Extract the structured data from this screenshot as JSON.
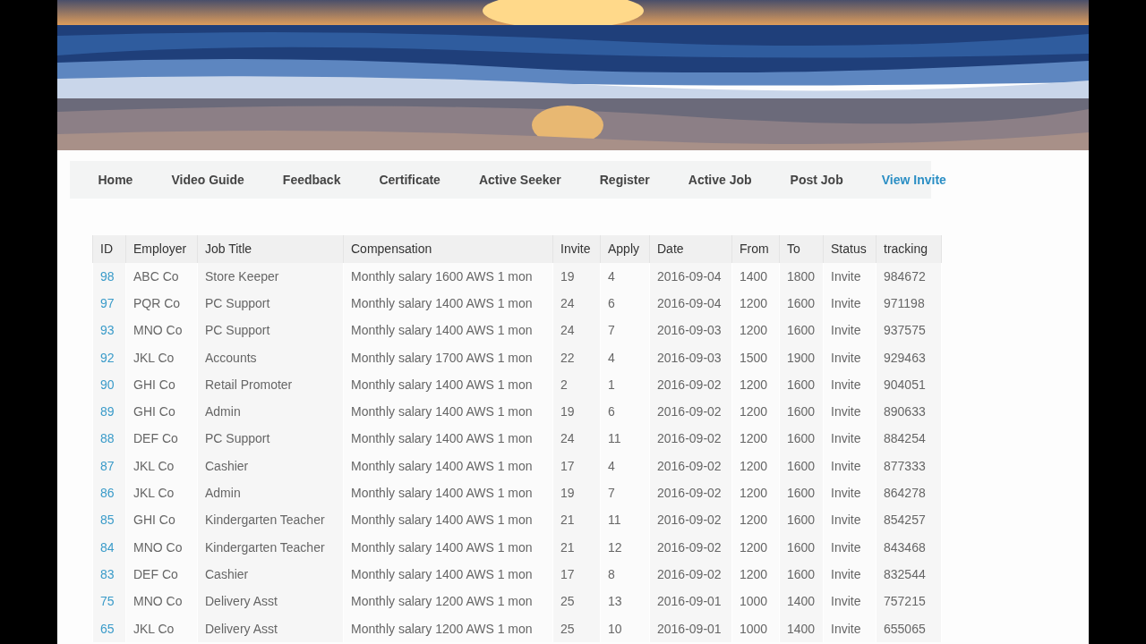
{
  "nav": [
    {
      "label": "Home",
      "selected": false
    },
    {
      "label": "Video Guide",
      "selected": false
    },
    {
      "label": "Feedback",
      "selected": false
    },
    {
      "label": "Certificate",
      "selected": false
    },
    {
      "label": "Active Seeker",
      "selected": false
    },
    {
      "label": "Register",
      "selected": false
    },
    {
      "label": "Active Job",
      "selected": false
    },
    {
      "label": "Post Job",
      "selected": false
    },
    {
      "label": "View Invite",
      "selected": true
    }
  ],
  "table": {
    "columns": [
      "ID",
      "Employer",
      "Job Title",
      "Compensation",
      "Invite",
      "Apply",
      "Date",
      "From",
      "To",
      "Status",
      "tracking"
    ],
    "rows": [
      [
        "98",
        "ABC Co",
        "Store Keeper",
        "Monthly salary 1600 AWS 1 mon",
        "19",
        "4",
        "2016-09-04",
        "1400",
        "1800",
        "Invite",
        "984672"
      ],
      [
        "97",
        "PQR Co",
        "PC Support",
        "Monthly salary 1400 AWS 1 mon",
        "24",
        "6",
        "2016-09-04",
        "1200",
        "1600",
        "Invite",
        "971198"
      ],
      [
        "93",
        "MNO Co",
        "PC Support",
        "Monthly salary 1400 AWS 1 mon",
        "24",
        "7",
        "2016-09-03",
        "1200",
        "1600",
        "Invite",
        "937575"
      ],
      [
        "92",
        "JKL Co",
        "Accounts",
        "Monthly salary 1700 AWS 1 mon",
        "22",
        "4",
        "2016-09-03",
        "1500",
        "1900",
        "Invite",
        "929463"
      ],
      [
        "90",
        "GHI Co",
        "Retail Promoter",
        "Monthly salary 1400 AWS 1 mon",
        "2",
        "1",
        "2016-09-02",
        "1200",
        "1600",
        "Invite",
        "904051"
      ],
      [
        "89",
        "GHI Co",
        "Admin",
        "Monthly salary 1400 AWS 1 mon",
        "19",
        "6",
        "2016-09-02",
        "1200",
        "1600",
        "Invite",
        "890633"
      ],
      [
        "88",
        "DEF Co",
        "PC Support",
        "Monthly salary 1400 AWS 1 mon",
        "24",
        "11",
        "2016-09-02",
        "1200",
        "1600",
        "Invite",
        "884254"
      ],
      [
        "87",
        "JKL Co",
        "Cashier",
        "Monthly salary 1400 AWS 1 mon",
        "17",
        "4",
        "2016-09-02",
        "1200",
        "1600",
        "Invite",
        "877333"
      ],
      [
        "86",
        "JKL Co",
        "Admin",
        "Monthly salary 1400 AWS 1 mon",
        "19",
        "7",
        "2016-09-02",
        "1200",
        "1600",
        "Invite",
        "864278"
      ],
      [
        "85",
        "GHI Co",
        "Kindergarten Teacher",
        "Monthly salary 1400 AWS 1 mon",
        "21",
        "11",
        "2016-09-02",
        "1200",
        "1600",
        "Invite",
        "854257"
      ],
      [
        "84",
        "MNO Co",
        "Kindergarten Teacher",
        "Monthly salary 1400 AWS 1 mon",
        "21",
        "12",
        "2016-09-02",
        "1200",
        "1600",
        "Invite",
        "843468"
      ],
      [
        "83",
        "DEF Co",
        "Cashier",
        "Monthly salary 1400 AWS 1 mon",
        "17",
        "8",
        "2016-09-02",
        "1200",
        "1600",
        "Invite",
        "832544"
      ],
      [
        "75",
        "MNO Co",
        "Delivery Asst",
        "Monthly salary 1200 AWS 1 mon",
        "25",
        "13",
        "2016-09-01",
        "1000",
        "1400",
        "Invite",
        "757215"
      ],
      [
        "65",
        "JKL Co",
        "Delivery Asst",
        "Monthly salary 1200 AWS 1 mon",
        "25",
        "10",
        "2016-09-01",
        "1000",
        "1400",
        "Invite",
        "655065"
      ]
    ]
  }
}
